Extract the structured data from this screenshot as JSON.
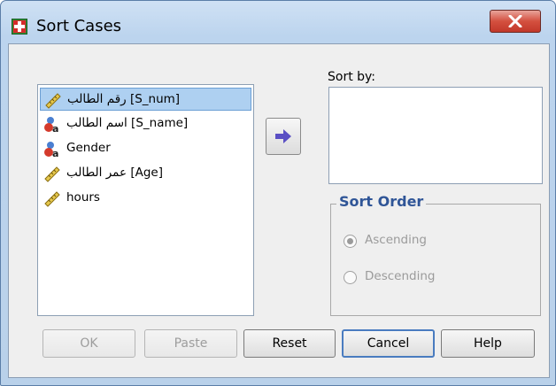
{
  "window": {
    "title": "Sort Cases",
    "icon": "spss-dialog-icon",
    "close_icon": "close-icon"
  },
  "variables": {
    "items": [
      {
        "label": "رقم الطالب [S_num]",
        "icon": "scale-ruler-icon",
        "selected": true
      },
      {
        "label": "اسم الطالب [S_name]",
        "icon": "nominal-icon",
        "selected": false
      },
      {
        "label": "Gender",
        "icon": "nominal-icon",
        "selected": false
      },
      {
        "label": "عمر الطالب [Age]",
        "icon": "scale-ruler-icon",
        "selected": false
      },
      {
        "label": "hours",
        "icon": "scale-ruler-icon",
        "selected": false
      }
    ]
  },
  "move_button": {
    "icon": "arrow-right-icon"
  },
  "sort_by": {
    "label": "Sort by:",
    "items": []
  },
  "sort_order": {
    "legend": "Sort Order",
    "options": [
      {
        "label": "Ascending",
        "checked": true,
        "enabled": false
      },
      {
        "label": "Descending",
        "checked": false,
        "enabled": false
      }
    ]
  },
  "buttons": {
    "ok": "OK",
    "paste": "Paste",
    "reset": "Reset",
    "cancel": "Cancel",
    "help": "Help"
  },
  "colors": {
    "accent": "#2f5597",
    "selection": "#aed0f1",
    "arrow": "#5a4fc4"
  }
}
